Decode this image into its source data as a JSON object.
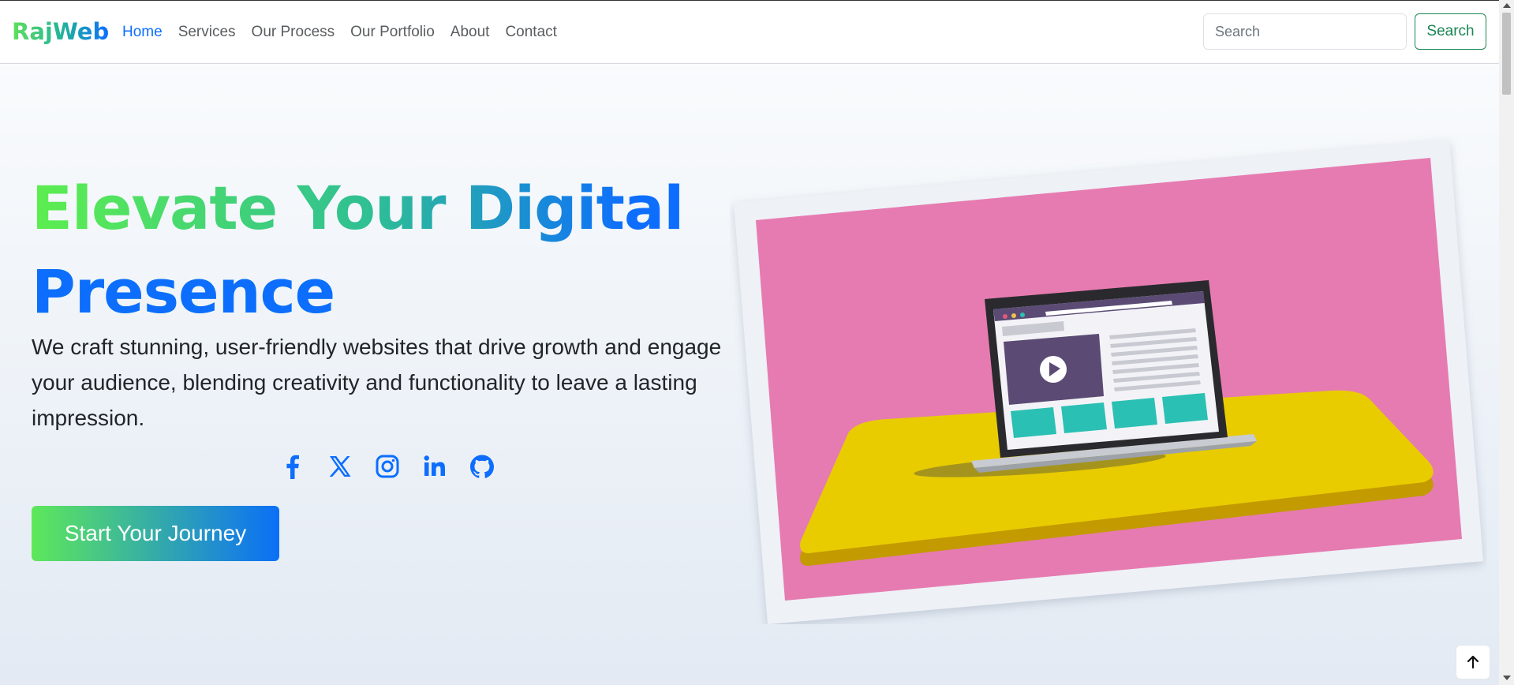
{
  "navbar": {
    "brand": "RajWeb",
    "links": [
      {
        "label": "Home",
        "active": true
      },
      {
        "label": "Services",
        "active": false
      },
      {
        "label": "Our Process",
        "active": false
      },
      {
        "label": "Our Portfolio",
        "active": false
      },
      {
        "label": "About",
        "active": false
      },
      {
        "label": "Contact",
        "active": false
      }
    ],
    "search_placeholder": "Search",
    "search_button": "Search"
  },
  "hero": {
    "title_line1": "Elevate Your Digital",
    "title_line2": "Presence",
    "description": "We craft stunning, user-friendly websites that drive growth and engage your audience, blending creativity and functionality to leave a lasting impression.",
    "socials": [
      "facebook-icon",
      "x-icon",
      "instagram-icon",
      "linkedin-icon",
      "github-icon"
    ],
    "cta_label": "Start Your Journey"
  },
  "colors": {
    "primary": "#0d6efd",
    "success": "#198754",
    "gradient_start": "#5ee85a",
    "illustration_bg": "#e878b0",
    "platform": "#e8cc00"
  },
  "scroll_top_icon": "arrow-up-icon"
}
